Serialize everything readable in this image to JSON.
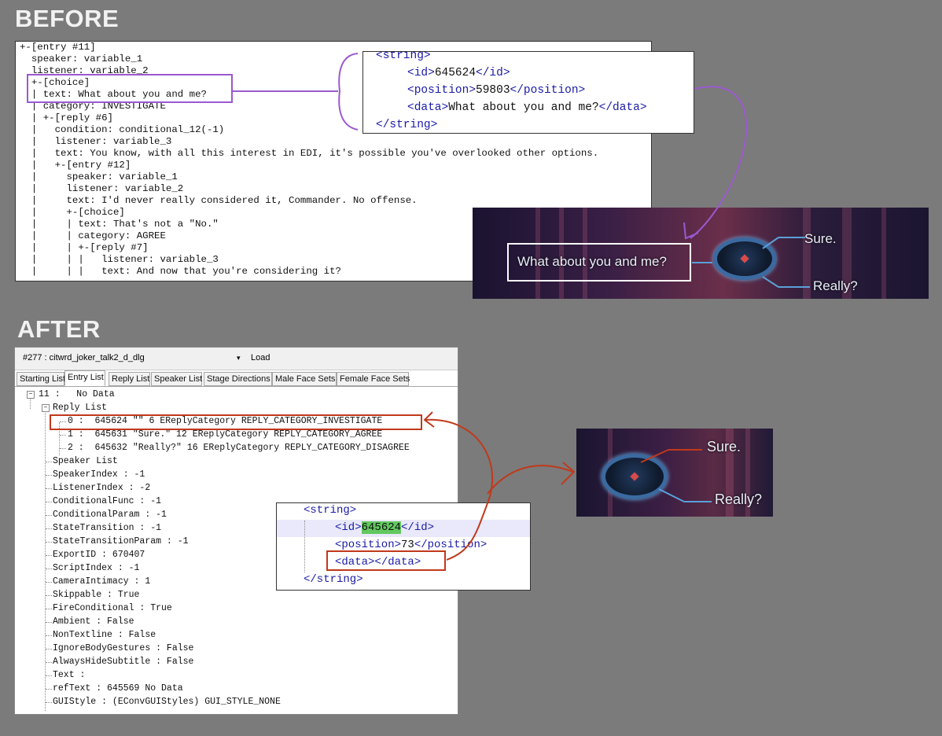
{
  "headings": {
    "before": "BEFORE",
    "after": "AFTER"
  },
  "before": {
    "tree_lines": [
      "+-[entry #11]",
      "  speaker: variable_1",
      "  listener: variable_2",
      "  +-[choice]",
      "  | text: What about you and me?",
      "  | category: INVESTIGATE",
      "  | +-[reply #6]",
      "  |   condition: conditional_12(-1)",
      "  |   listener: variable_3",
      "  |   text: You know, with all this interest in EDI, it's possible you've overlooked other options.",
      "  |   +-[entry #12]",
      "  |     speaker: variable_1",
      "  |     listener: variable_2",
      "  |     text: I'd never really considered it, Commander. No offense.",
      "  |     +-[choice]",
      "  |     | text: That's not a \"No.\"",
      "  |     | category: AGREE",
      "  |     | +-[reply #7]",
      "  |     | |   listener: variable_3",
      "  |     | |   text: And now that you're considering it?"
    ],
    "xml": {
      "open": "<string>",
      "id_open": "<id>",
      "id_value": "645624",
      "id_close": "</id>",
      "pos_open": "<position>",
      "pos_value": "59803",
      "pos_close": "</position>",
      "data_open": "<data>",
      "data_value": "What about you and me?",
      "data_close": "</data>",
      "close": "</string>"
    },
    "game": {
      "prompt": "What about you and me?",
      "option_top": "Sure.",
      "option_bottom": "Really?"
    }
  },
  "after": {
    "toolbar": {
      "combo_value": "#277 : citwrd_joker_talk2_d_dlg",
      "load_label": "Load"
    },
    "tabs": [
      "Starting List",
      "Entry List",
      "Reply List",
      "Speaker List",
      "Stage Directions",
      "Male Face Sets",
      "Female Face Sets"
    ],
    "active_tab": "Entry List",
    "tree": {
      "root": "11 :   No Data",
      "reply_list_label": "Reply List",
      "replies": [
        "0 :  645624 \"\" 6 EReplyCategory REPLY_CATEGORY_INVESTIGATE",
        "1 :  645631 \"Sure.\" 12 EReplyCategory REPLY_CATEGORY_AGREE",
        "2 :  645632 \"Really?\" 16 EReplyCategory REPLY_CATEGORY_DISAGREE"
      ],
      "properties": [
        "Speaker List",
        "SpeakerIndex : -1",
        "ListenerIndex : -2",
        "ConditionalFunc : -1",
        "ConditionalParam : -1",
        "StateTransition : -1",
        "StateTransitionParam : -1",
        "ExportID : 670407",
        "ScriptIndex : -1",
        "CameraIntimacy : 1",
        "Skippable : True",
        "FireConditional : True",
        "Ambient : False",
        "NonTextline : False",
        "IgnoreBodyGestures : False",
        "AlwaysHideSubtitle : False",
        "Text :",
        "refText : 645569 No Data",
        "GUIStyle : (EConvGUIStyles) GUI_STYLE_NONE"
      ]
    },
    "xml": {
      "open": "<string>",
      "id_open": "<id>",
      "id_value": "645624",
      "id_close": "</id>",
      "pos_open": "<position>",
      "pos_value": "73",
      "pos_close": "</position>",
      "data_open": "<data>",
      "data_close": "</data>",
      "close": "</string>"
    },
    "game": {
      "option_top": "Sure.",
      "option_bottom": "Really?"
    }
  },
  "colors": {
    "background": "#7b7b7b",
    "purple_highlight": "#9b59d0",
    "red_highlight": "#c0391b",
    "xml_tag": "#1a1aa6",
    "id_highlight": "#62c85f"
  }
}
